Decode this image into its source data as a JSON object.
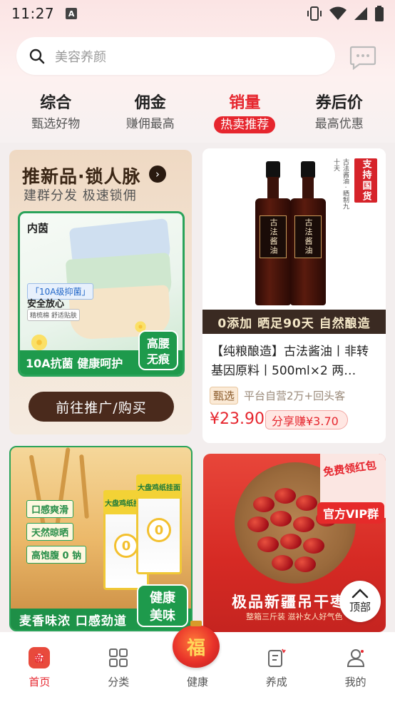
{
  "status_bar": {
    "time": "11:27",
    "a_badge": "A"
  },
  "search": {
    "placeholder": "美容养颜"
  },
  "tabs": [
    {
      "title": "综合",
      "sub": "甄选好物"
    },
    {
      "title": "佣金",
      "sub": "赚佣最高"
    },
    {
      "title": "销量",
      "sub": "热卖推荐"
    },
    {
      "title": "券后价",
      "sub": "最高优惠"
    }
  ],
  "active_tab": "销量",
  "promo": {
    "title": "推新品·锁人脉",
    "arrow": "›",
    "subtitle": "建群分发 极速锁佣",
    "brand": "内茵",
    "tag_10a": "「10A级抑菌」",
    "tag_safe": "安全放心",
    "tag_mini": "精梳棉 舒适贴肤",
    "strip": "10A抗菌 健康呵护",
    "badge_line1": "高腰",
    "badge_line2": "无痕",
    "button": "前往推广/购买"
  },
  "product1": {
    "bottle_label": "古法酱油",
    "country_tag": "支持国货",
    "side_note": "古法酱油 · 晒制九十天",
    "banner": "0添加  晒足90天  自然酿造",
    "title": "【纯粮酿造】古法酱油丨非转基因原料丨500ml×2 两…",
    "pick_tag": "甄选",
    "meta": "平台自营2万+回头客",
    "price": "¥23.90",
    "share": "分享赚¥3.70"
  },
  "product2": {
    "tag1": "口感爽滑",
    "tag2": "天然晾晒",
    "tag3": "高饱腹 0 钠",
    "pack_label": "大盘鸡纸挂面",
    "pack_zero": "0",
    "strip": "麦香味浓 口感劲道",
    "badge_line1": "健康",
    "badge_line2": "美味"
  },
  "product3": {
    "redpacket": "免费领红包",
    "vip": "官方VIP群",
    "title": "极品新疆吊干枣",
    "sub": "整箱三斤装 滋补女人好气色"
  },
  "top_button": {
    "label": "顶部"
  },
  "bottom_nav": [
    {
      "label": "首页",
      "icon": "home-icon",
      "glyph": "新"
    },
    {
      "label": "分类",
      "icon": "category-icon"
    },
    {
      "label": "健康",
      "icon": "health-icon",
      "glyph": "福"
    },
    {
      "label": "养成",
      "icon": "grow-icon"
    },
    {
      "label": "我的",
      "icon": "profile-icon"
    }
  ],
  "colors": {
    "accent": "#e6262e",
    "green": "#1e9a4c",
    "brown": "#4a2a1c"
  }
}
